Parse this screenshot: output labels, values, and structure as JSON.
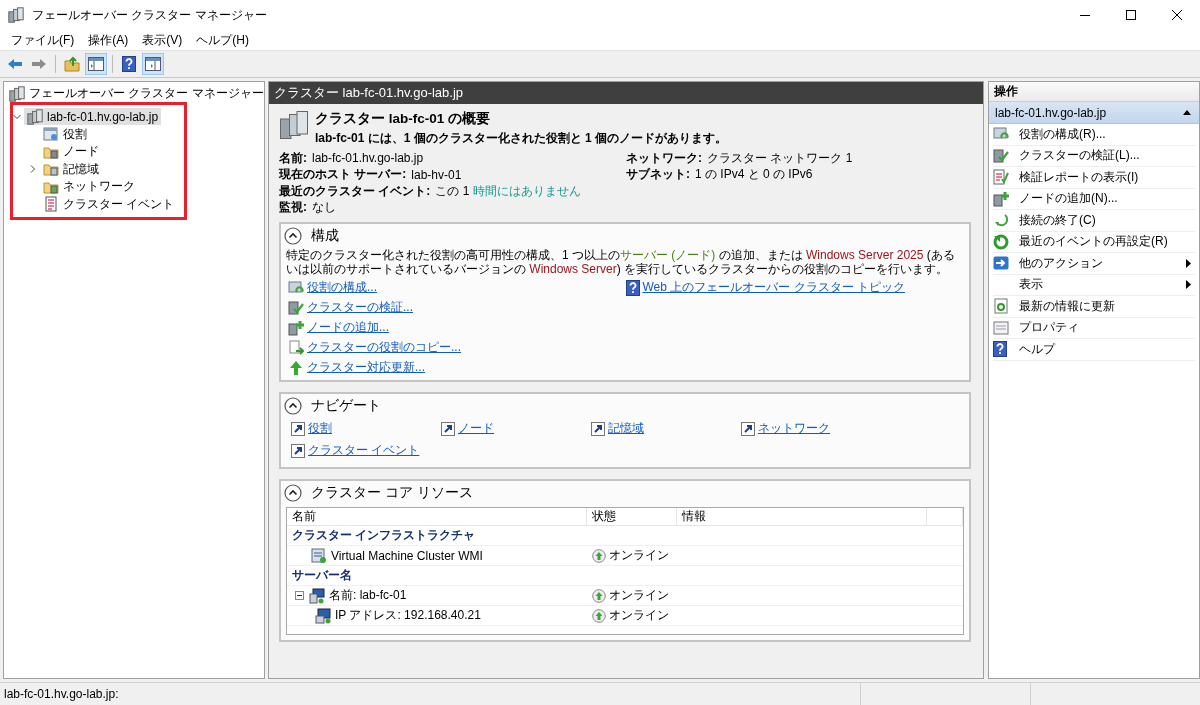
{
  "window": {
    "title": "フェールオーバー クラスター マネージャー"
  },
  "menu": [
    "ファイル(F)",
    "操作(A)",
    "表示(V)",
    "ヘルプ(H)"
  ],
  "toolbar": [
    {
      "kind": "back",
      "disabled": false,
      "on": false
    },
    {
      "kind": "forward",
      "disabled": true,
      "on": false
    },
    {
      "kind": "up",
      "disabled": false,
      "on": false
    },
    {
      "kind": "console-tree",
      "disabled": false,
      "on": true
    },
    {
      "kind": "help",
      "disabled": false,
      "on": false
    },
    {
      "kind": "action-pane",
      "disabled": false,
      "on": true
    }
  ],
  "tree": {
    "items": [
      {
        "label": "フェールオーバー クラスター マネージャー",
        "selected": false,
        "children": [
          {
            "label": "lab-fc-01.hv.go-lab.jp",
            "selected": true,
            "expanded": true,
            "children": [
              {
                "label": "役割",
                "selected": false
              },
              {
                "label": "ノード",
                "selected": false
              },
              {
                "label": "記憶域",
                "selected": false,
                "expanded": false
              },
              {
                "label": "ネットワーク",
                "selected": false
              },
              {
                "label": "クラスター イベント",
                "selected": false
              }
            ]
          }
        ]
      }
    ]
  },
  "main": {
    "header": "クラスター lab-fc-01.hv.go-lab.jp",
    "summary": {
      "title": "クラスター lab-fc-01 の概要",
      "subtitle": "lab-fc-01 には、1 個のクラスター化された役割と 1 個のノードがあります。",
      "fields_left": [
        {
          "label": "名前:",
          "value": "lab-fc-01.hv.go-lab.jp"
        },
        {
          "label": "現在のホスト サーバー:",
          "value": "lab-hv-01"
        },
        {
          "label": "最近のクラスター イベント:",
          "value_parts": [
            {
              "text": "この 1 ",
              "kind": "plain"
            },
            {
              "text": "時間にはありません",
              "kind": "status"
            }
          ]
        },
        {
          "label": "監視:",
          "value": "なし"
        }
      ],
      "fields_right": [
        {
          "label": "ネットワーク:",
          "value": "クラスター ネットワーク 1"
        },
        {
          "label": "サブネット:",
          "value": "1 の IPv4 と 0 の IPv6"
        }
      ]
    },
    "sections": [
      {
        "kind": "configure",
        "title": "構成",
        "expanded": true,
        "description": [
          {
            "text": "特定のクラスター化された役割の高可用性の構成、1 つ以上の",
            "kind": "plain"
          },
          {
            "text": "サーバー (ノード)",
            "kind": "term"
          },
          {
            "text": " の追加、または ",
            "kind": "plain"
          },
          {
            "text": "Windows Server 2025",
            "kind": "product"
          },
          {
            "text": " (あるいは以前のサポートされているバージョンの ",
            "kind": "plain"
          },
          {
            "text": "Windows Server",
            "kind": "product"
          },
          {
            "text": ") を実行しているクラスターからの役割のコピーを行います。",
            "kind": "plain"
          }
        ],
        "links_left": [
          "役割の構成...",
          "クラスターの検証...",
          "ノードの追加...",
          "クラスターの役割のコピー...",
          "クラスター対応更新..."
        ],
        "links_right": [
          "Web 上のフェールオーバー クラスター トピック"
        ]
      },
      {
        "kind": "navigate",
        "title": "ナビゲート",
        "expanded": true,
        "links": [
          "役割",
          "ノード",
          "記憶域",
          "ネットワーク",
          "クラスター イベント"
        ]
      },
      {
        "kind": "resources",
        "title": "クラスター コア リソース",
        "expanded": true,
        "table": {
          "columns": [
            "名前",
            "状態",
            "情報"
          ],
          "groups": [
            {
              "title": "クラスター インフラストラクチャ",
              "rows": [
                {
                  "name": "Virtual Machine Cluster WMI",
                  "status": "オンライン"
                }
              ]
            },
            {
              "title": "サーバー名",
              "rows": [
                {
                  "name": "名前: lab-fc-01",
                  "status": "オンライン",
                  "expanded": true,
                  "children": [
                    {
                      "name": "IP アドレス: 192.168.40.21",
                      "status": "オンライン"
                    }
                  ]
                }
              ]
            }
          ]
        }
      }
    ]
  },
  "actions": {
    "title": "操作",
    "group": {
      "label": "lab-fc-01.hv.go-lab.jp",
      "expanded": true,
      "items": [
        {
          "label": "役割の構成(R)...",
          "submenu": false
        },
        {
          "label": "クラスターの検証(L)...",
          "submenu": false
        },
        {
          "label": "検証レポートの表示(I)",
          "submenu": false
        },
        {
          "label": "ノードの追加(N)...",
          "submenu": false
        },
        {
          "label": "接続の終了(C)",
          "submenu": false
        },
        {
          "label": "最近のイベントの再設定(R)",
          "submenu": false
        },
        {
          "label": "他のアクション",
          "submenu": true
        },
        {
          "label": "表示",
          "submenu": true
        },
        {
          "label": "最新の情報に更新",
          "submenu": false
        },
        {
          "label": "プロパティ",
          "submenu": false
        },
        {
          "label": "ヘルプ",
          "submenu": false
        }
      ]
    }
  },
  "status_bar": {
    "text": "lab-fc-01.hv.go-lab.jp:"
  }
}
